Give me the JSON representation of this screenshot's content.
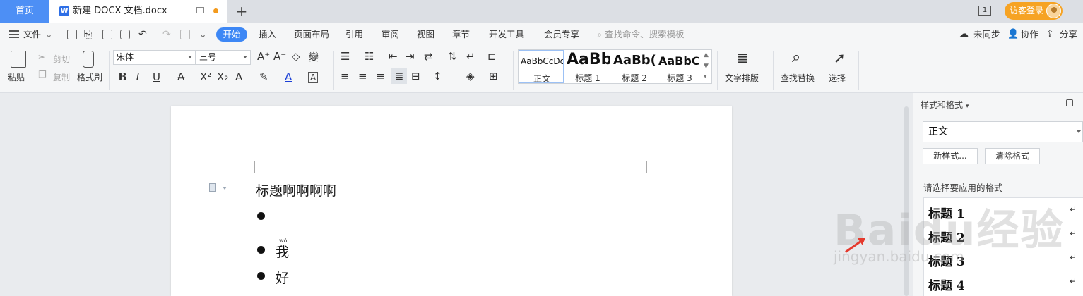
{
  "tabbar": {
    "home_tab": "首页",
    "doc_tab_icon": "W",
    "doc_tab_title": "新建 DOCX 文档.docx",
    "add_tab": "+",
    "layout_icon": "1",
    "login_label": "访客登录"
  },
  "menubar": {
    "file_label": "文件",
    "tabs": [
      "开始",
      "插入",
      "页面布局",
      "引用",
      "审阅",
      "视图",
      "章节",
      "开发工具",
      "会员专享"
    ],
    "search_placeholder": "查找命令、搜索模板",
    "sync_label": "未同步",
    "collab_label": "协作",
    "share_label": "分享"
  },
  "ribbon": {
    "paste": "粘贴",
    "cut": "剪切",
    "copy": "复制",
    "format_painter": "格式刷",
    "font_name": "宋体",
    "font_size": "三号",
    "styles": [
      {
        "sample": "AaBbCcDd",
        "label": "正文"
      },
      {
        "sample": "AaBb",
        "label": "标题 1"
      },
      {
        "sample": "AaBb(",
        "label": "标题 2"
      },
      {
        "sample": "AaBbC",
        "label": "标题 3"
      }
    ],
    "text_layout": "文字排版",
    "find_replace": "查找替换",
    "select": "选择"
  },
  "document": {
    "lines": [
      "标题啊啊啊啊",
      "",
      "我",
      "好"
    ],
    "pinyin": "wǒ"
  },
  "panel": {
    "title": "样式和格式",
    "current_style": "正文",
    "new_style_button": "新样式...",
    "clear_format_button": "清除格式",
    "hint": "请选择要应用的格式",
    "style_list": [
      "标题 1",
      "标题 2",
      "标题 3",
      "标题 4"
    ],
    "enter_mark": "↵"
  },
  "watermark": {
    "text": "Baidu经验",
    "url": "jingyan.baidu.com"
  },
  "colors": {
    "accent": "#3d87f5",
    "login": "#f6a323",
    "arrow": "#e53a2e"
  }
}
